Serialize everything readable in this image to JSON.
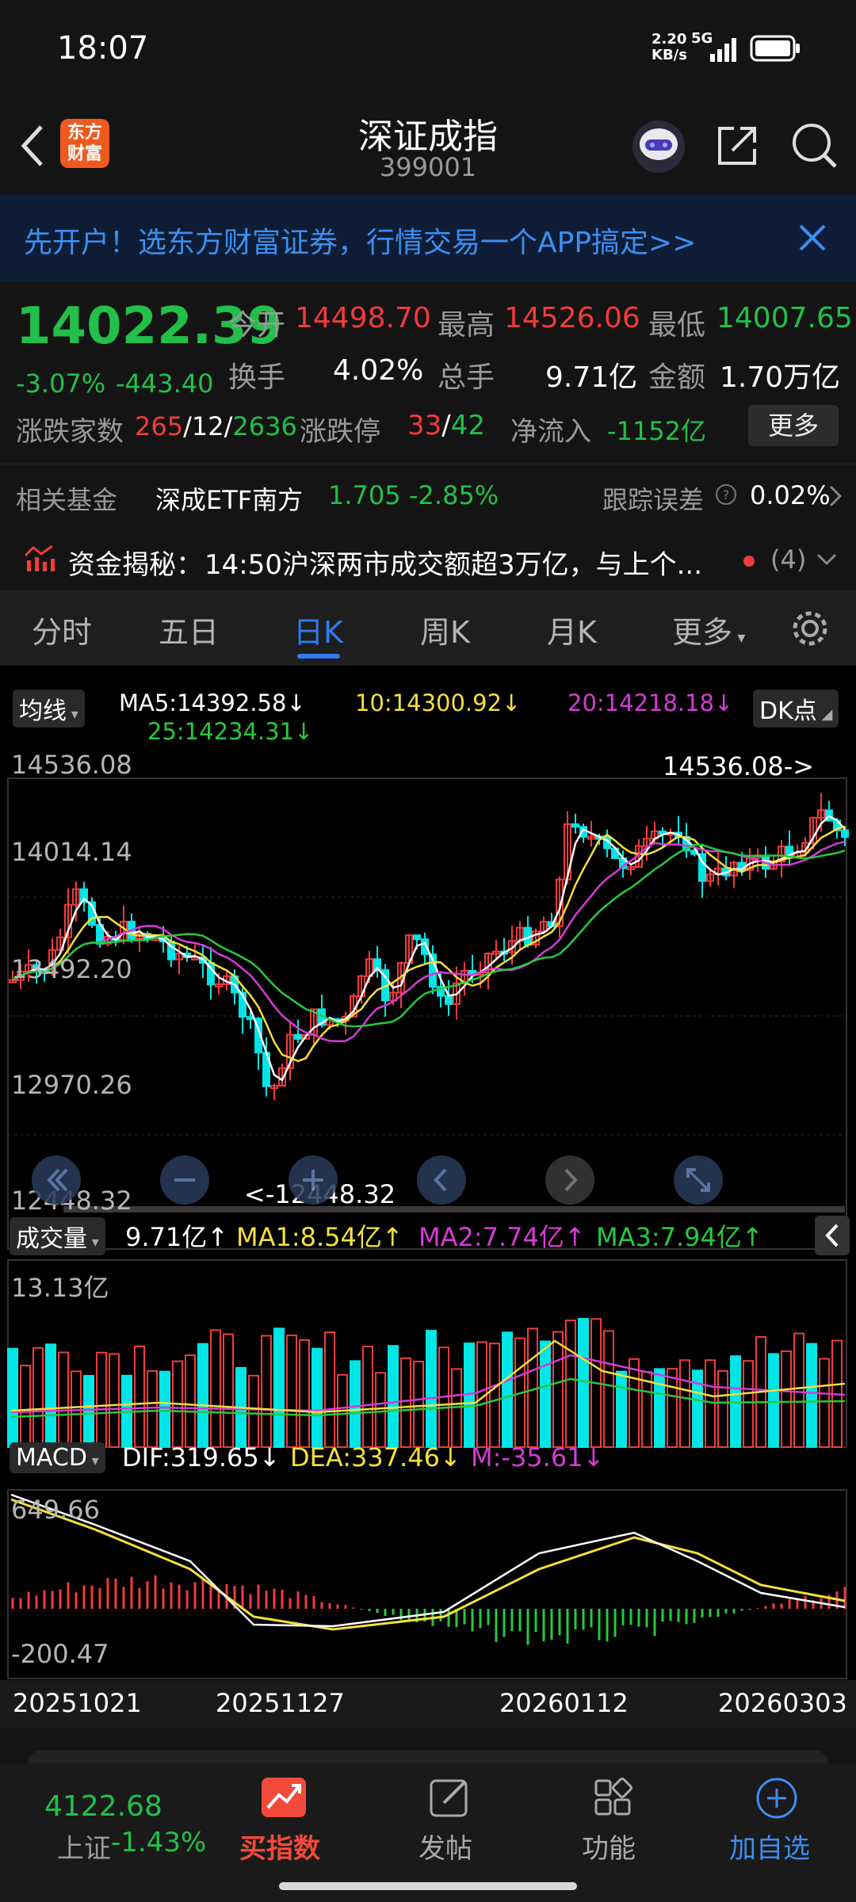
{
  "status": {
    "time": "18:07",
    "net_speed": "2.20",
    "net_unit": "KB/s",
    "net_type": "5G"
  },
  "nav": {
    "title": "深证成指",
    "code": "399001",
    "logo_text_1": "东方",
    "logo_text_2": "财富"
  },
  "banner": {
    "text": "先开户！选东方财富证券，行情交易一个APP搞定>>"
  },
  "quote": {
    "price": "14022.39",
    "pct": "-3.07%",
    "chg": "-443.40",
    "open_label": "今开",
    "open": "14498.70",
    "high_label": "最高",
    "high": "14526.06",
    "low_label": "最低",
    "low": "14007.65",
    "turnover_label": "换手",
    "turnover": "4.02%",
    "vol_label": "总手",
    "vol": "9.71亿",
    "amount_label": "金额",
    "amount": "1.70万亿",
    "updown_label": "涨跌家数",
    "up": "265",
    "flat": "12",
    "down": "2636",
    "limit_label": "涨跌停",
    "limit_up": "33",
    "limit_down": "42",
    "netflow_label": "净流入",
    "netflow": "-1152亿",
    "more_label": "更多"
  },
  "fund": {
    "label": "相关基金",
    "name": "深成ETF南方",
    "price": "1.705",
    "pct": "-2.85%",
    "err_label": "跟踪误差",
    "err": "0.02%"
  },
  "news": {
    "prefix": "资金揭秘：",
    "text": "14:50沪深两市成交额超3万亿，与上个...",
    "count": "(4)"
  },
  "tabs": [
    "分时",
    "五日",
    "日K",
    "周K",
    "月K",
    "更多"
  ],
  "chart": {
    "ma_selector": "均线",
    "ma5": "MA5:14392.58↓",
    "ma10": "10:14300.92↓",
    "ma20": "20:14218.18↓",
    "ma25": "25:14234.31↓",
    "dk": "DK点",
    "y_labels": [
      "14536.08",
      "14014.14",
      "13492.20",
      "12970.26",
      "12448.32"
    ],
    "max_note": "14536.08->",
    "min_note": "<-12448.32",
    "vol_selector": "成交量",
    "vol_val": "9.71亿↑",
    "vol_ma1": "MA1:8.54亿↑",
    "vol_ma2": "MA2:7.74亿↑",
    "vol_ma3": "MA3:7.94亿↑",
    "vol_max": "13.13亿",
    "macd_selector": "MACD",
    "dif": "DIF:319.65↓",
    "dea": "DEA:337.46↓",
    "mval": "M:-35.61↓",
    "macd_max": "649.66",
    "macd_min": "-200.47",
    "dates": [
      "20251021",
      "20251127",
      "20260112",
      "20260303"
    ]
  },
  "bottom": {
    "sh_price": "4122.68",
    "sh_label": "上证",
    "sh_pct": "-1.43%",
    "buy": "买指数",
    "post": "发帖",
    "func": "功能",
    "add": "加自选"
  },
  "colors": {
    "up": "#f23b3b",
    "down": "#00e5e5",
    "accent": "#2f7bf0",
    "ma5": "#ffffff",
    "ma10": "#f5e03b",
    "ma20": "#d63bd6",
    "ma25": "#26c93f"
  }
}
